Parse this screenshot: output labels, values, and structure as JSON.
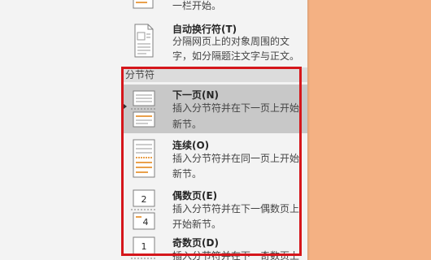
{
  "menu": {
    "top_partial": {
      "desc_line2": "一栏开始。"
    },
    "text_wrap": {
      "title": "自动换行符(T)",
      "desc_line1": "分隔网页上的对象周围的文",
      "desc_line2": "字，如分隔题注文字与正文。"
    },
    "section_breaks_header": "分节符",
    "items": [
      {
        "title": "下一页(N)",
        "desc_line1": "插入分节符并在下一页上开始",
        "desc_line2": "新节。",
        "icon": "next-page-break-icon",
        "highlighted": true
      },
      {
        "title": "连续(O)",
        "desc_line1": "插入分节符并在同一页上开始",
        "desc_line2": "新节。",
        "icon": "continuous-break-icon"
      },
      {
        "title": "偶数页(E)",
        "desc_line1": "插入分节符并在下一偶数页上",
        "desc_line2": "开始新节。",
        "icon": "even-page-break-icon",
        "icon_labels": [
          "2",
          "4"
        ]
      },
      {
        "title": "奇数页(D)",
        "desc_line1": "插入分节符并在下一奇数页上",
        "icon": "odd-page-break-icon",
        "icon_labels": [
          "1"
        ]
      }
    ]
  },
  "colors": {
    "document_background": "#f4b183",
    "menu_background": "#f3f3f3",
    "highlight": "#c8c8c8",
    "annotation_border": "#d5161b",
    "icon_accent": "#e9a04b"
  }
}
